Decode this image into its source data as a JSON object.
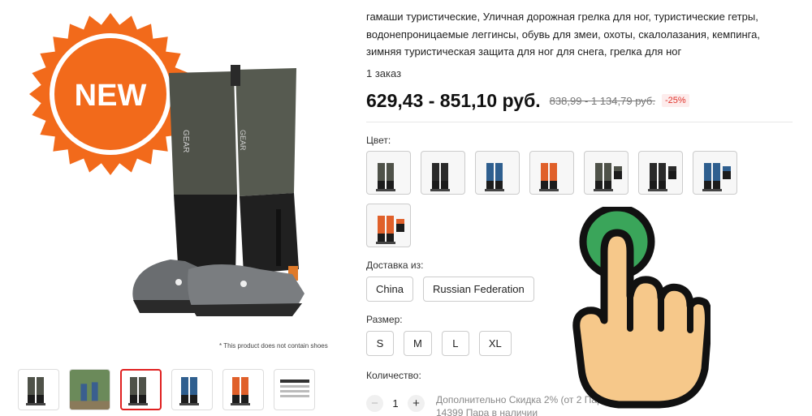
{
  "badge": {
    "text": "NEW"
  },
  "product": {
    "title": "гамаши туристические, Уличная дорожная грелка для ног, туристические гетры, водонепроницаемые леггинсы, обувь для змеи, охоты, скалолазания, кемпинга, зимняя туристическая защита для ног для снега, грелка для ног",
    "orders": "1 заказ",
    "price": "629,43 - 851,10 руб.",
    "old_price": "838,99 - 1 134,79 руб.",
    "discount": "-25%",
    "disclaimer": "* This product does not contain shoes"
  },
  "color": {
    "label": "Цвет:",
    "swatches": [
      {
        "name": "gray-black",
        "c1": "#4f5249",
        "c2": "#1c1c1c"
      },
      {
        "name": "black",
        "c1": "#2a2a2a",
        "c2": "#1a1a1a"
      },
      {
        "name": "blue",
        "c1": "#2f5f8f",
        "c2": "#1c1c1c"
      },
      {
        "name": "orange",
        "c1": "#e0602a",
        "c2": "#1c1c1c"
      },
      {
        "name": "gray-set",
        "c1": "#4f5249",
        "c2": "#1c1c1c"
      },
      {
        "name": "black-set",
        "c1": "#2a2a2a",
        "c2": "#1a1a1a"
      },
      {
        "name": "blue-set",
        "c1": "#2f5f8f",
        "c2": "#1c1c1c"
      },
      {
        "name": "orange-set",
        "c1": "#e0602a",
        "c2": "#1c1c1c"
      }
    ]
  },
  "shipping": {
    "label": "Доставка из:",
    "options": [
      "China",
      "Russian Federation"
    ]
  },
  "size": {
    "label": "Размер:",
    "options": [
      "S",
      "M",
      "L",
      "XL"
    ]
  },
  "quantity": {
    "label": "Количество:",
    "value": "1",
    "minus": "−",
    "plus": "+",
    "extra_discount": "Дополнительно Скидка 2% (от 2 Пара)",
    "stock": "14399 Пара в наличии"
  },
  "thumbnails": [
    {
      "name": "gray",
      "c1": "#4f5249",
      "active": false
    },
    {
      "name": "lifestyle",
      "c1": "#6b8a5a",
      "active": false
    },
    {
      "name": "gray-side",
      "c1": "#4f5249",
      "active": true
    },
    {
      "name": "blue",
      "c1": "#2f5f8f",
      "active": false
    },
    {
      "name": "orange",
      "c1": "#e0602a",
      "active": false
    },
    {
      "name": "size-chart",
      "c1": "#dddddd",
      "active": false
    }
  ],
  "colors": {
    "accent": "#e0332b",
    "badge": "#f26a1b",
    "hand_skin": "#f6c88a",
    "hand_dot": "#3aa55a"
  }
}
